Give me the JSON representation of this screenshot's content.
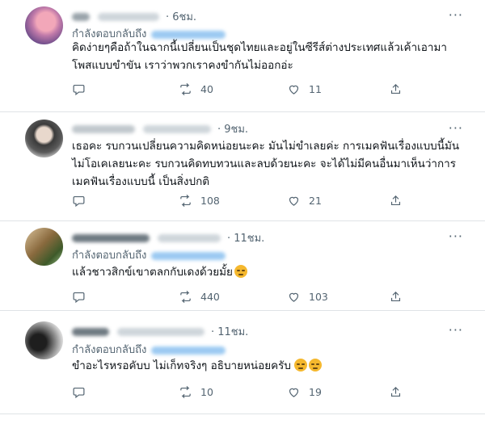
{
  "tweets": [
    {
      "time": "· 6ชม.",
      "replying": "กำลังตอบกลับถึง",
      "text": "คิดง่ายๆคือถ้าในฉากนี้เปลี่ยนเป็นชุดไทยและอยู่ในซีรีส์ต่างประเทศแล้วเค้าเอามาโพสแบบขำขัน เราว่าพวกเราคงขำกันไม่ออกอ่ะ",
      "retweets": "40",
      "likes": "11"
    },
    {
      "time": "· 9ชม.",
      "replying": "",
      "text": "เธอคะ รบกวนเปลี่ยนความคิดหน่อยนะคะ มันไม่ขำเลยค่ะ การเมคฟันเรื่องแบบนี้มันไม่โอเคเลยนะคะ รบกวนคิดทบทวนและลบด้วยนะคะ จะได้ไม่มีคนอื่นมาเห็นว่าการเมคฟันเรื่องแบบนี้ เป็นสิ่งปกติ",
      "retweets": "108",
      "likes": "21"
    },
    {
      "time": "· 11ชม.",
      "replying": "กำลังตอบกลับถึง",
      "text": "แล้วชาวสิกข์เขาตลกกับเดงด้วยมั้ย",
      "retweets": "440",
      "likes": "103"
    },
    {
      "time": "· 11ชม.",
      "replying": "กำลังตอบกลับถึง",
      "text": "ขำอะไรหรอคับบ ไม่เก็ทจริงๆ อธิบายหน่อยครับ",
      "retweets": "10",
      "likes": "19"
    }
  ],
  "icons": {
    "more": "more-icon",
    "reply": "reply-icon",
    "retweet": "retweet-icon",
    "like": "heart-icon",
    "share": "share-icon"
  },
  "colors": {
    "text_primary": "#0f1419",
    "text_secondary": "#536471",
    "divider": "#dfe3e6",
    "link": "#1d9bf0"
  }
}
